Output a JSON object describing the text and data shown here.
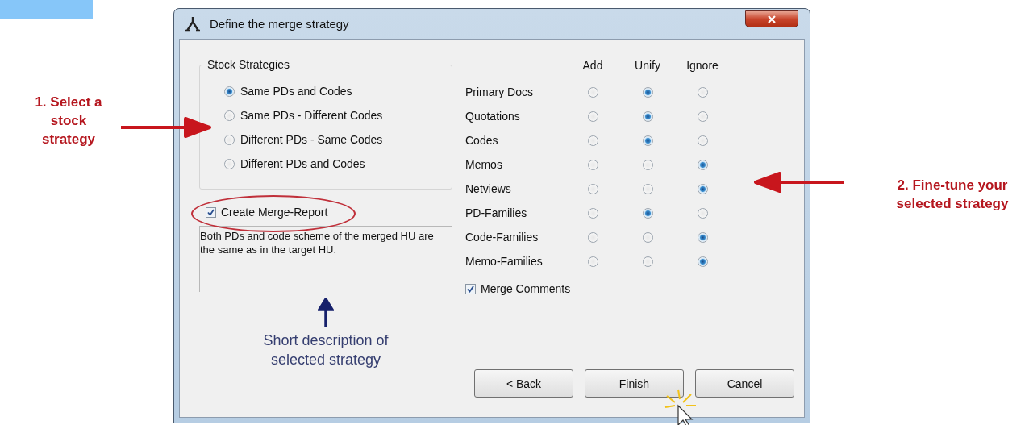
{
  "window": {
    "title": "Define the merge strategy"
  },
  "stock_strategies": {
    "title": "Stock Strategies",
    "options": [
      {
        "label": "Same PDs and Codes",
        "selected": true
      },
      {
        "label": "Same PDs - Different Codes",
        "selected": false
      },
      {
        "label": "Different PDs - Same Codes",
        "selected": false
      },
      {
        "label": "Different PDs and Codes",
        "selected": false
      }
    ]
  },
  "create_report": {
    "label": "Create Merge-Report",
    "checked": true
  },
  "description": "Both PDs and code scheme of the merged HU are the same as in the target HU.",
  "matrix": {
    "columns": [
      "Add",
      "Unify",
      "Ignore"
    ],
    "rows": [
      {
        "label": "Primary Docs",
        "choices": [
          {
            "selected": false
          },
          {
            "selected": true
          },
          {
            "selected": false
          }
        ]
      },
      {
        "label": "Quotations",
        "choices": [
          {
            "selected": false
          },
          {
            "selected": true
          },
          {
            "selected": false
          }
        ]
      },
      {
        "label": "Codes",
        "choices": [
          {
            "selected": false
          },
          {
            "selected": true
          },
          {
            "selected": false
          }
        ]
      },
      {
        "label": "Memos",
        "choices": [
          {
            "selected": false
          },
          {
            "selected": false
          },
          {
            "selected": true
          }
        ]
      },
      {
        "label": "Netviews",
        "choices": [
          {
            "selected": false
          },
          {
            "selected": false
          },
          {
            "selected": true
          }
        ]
      },
      {
        "label": "PD-Families",
        "choices": [
          {
            "selected": false
          },
          {
            "selected": true
          },
          {
            "selected": false
          }
        ]
      },
      {
        "label": "Code-Families",
        "choices": [
          {
            "selected": false
          },
          {
            "selected": false
          },
          {
            "selected": true
          }
        ]
      },
      {
        "label": "Memo-Families",
        "choices": [
          {
            "selected": false
          },
          {
            "selected": false
          },
          {
            "selected": true
          }
        ]
      }
    ]
  },
  "merge_comments": {
    "label": "Merge Comments",
    "checked": true
  },
  "buttons": [
    "< Back",
    "Finish",
    "Cancel"
  ],
  "annotations": {
    "left": "1. Select a\nstock\nstrategy",
    "right": "2. Fine-tune your\nselected strategy",
    "description": "Short description of\nselected strategy"
  }
}
